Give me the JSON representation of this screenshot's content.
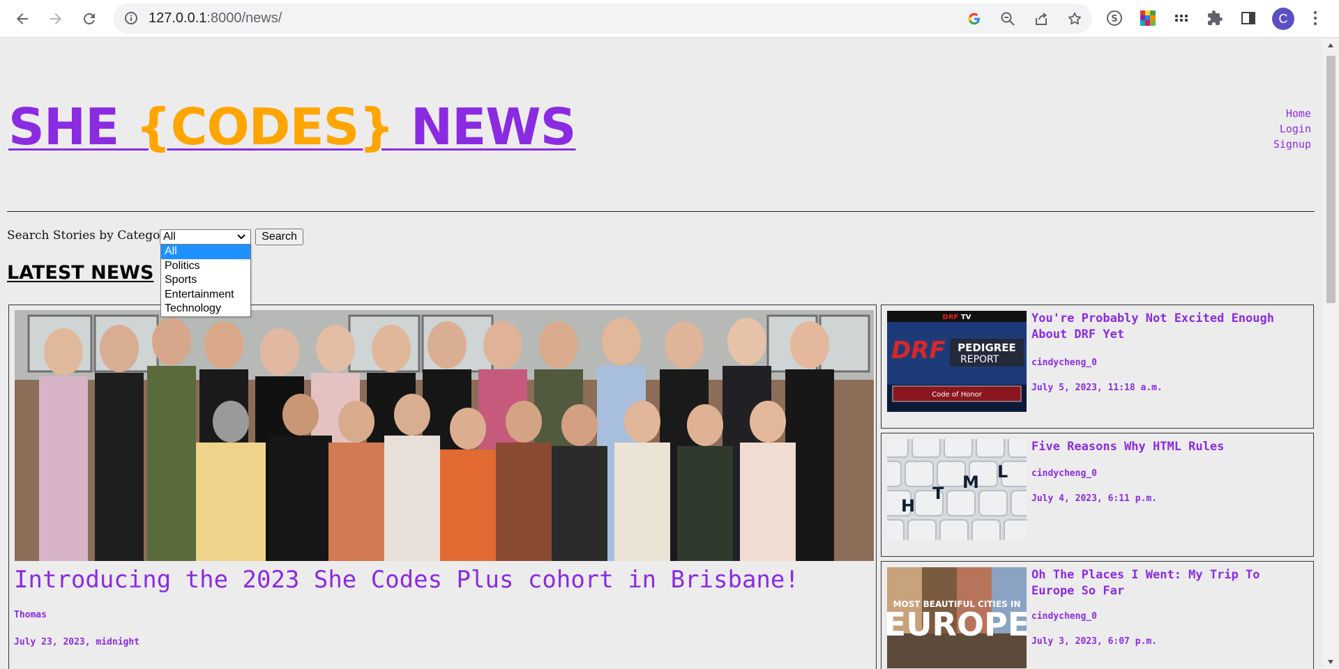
{
  "browser": {
    "url_host": "127.0.0.1",
    "url_rest": ":8000/news/",
    "avatar_letter": "C"
  },
  "site": {
    "logo_part1": "SHE ",
    "logo_part2": "{CODES}",
    "logo_part3": " NEWS",
    "brand_color": "#8a2be2",
    "accent_color": "#ffa500",
    "nav": [
      "Home",
      "Login",
      "Signup"
    ]
  },
  "search": {
    "label": "Search Stories by Category:",
    "selected": "All",
    "options": [
      "All",
      "Politics",
      "Sports",
      "Entertainment",
      "Technology"
    ],
    "button": "Search"
  },
  "section_title": "LATEST NEWS",
  "feature": {
    "title": "Introducing the 2023 She Codes Plus cohort in Brisbane!",
    "author": "Thomas",
    "date": "July 23, 2023, midnight"
  },
  "stories": [
    {
      "title": "You're Probably Not Excited Enough About DRF Yet",
      "author": "cindycheng_0",
      "date": "July 5, 2023, 11:18 a.m.",
      "thumb_text_1": "DRF",
      "thumb_text_2": "TV",
      "thumb_text_3": "PEDIGREE",
      "thumb_text_4": "REPORT",
      "thumb_text_5": "Code of Honor"
    },
    {
      "title": "Five Reasons Why HTML Rules",
      "author": "cindycheng_0",
      "date": "July 4, 2023, 6:11 p.m.",
      "thumb_keys": [
        "H",
        "T",
        "M",
        "L"
      ]
    },
    {
      "title": "Oh The Places I Went: My Trip To Europe So Far",
      "author": "cindycheng_0",
      "date": "July 3, 2023, 6:07 p.m.",
      "thumb_text_1": "MOST BEAUTIFUL CITIES IN",
      "thumb_text_2": "EUROPE"
    }
  ]
}
